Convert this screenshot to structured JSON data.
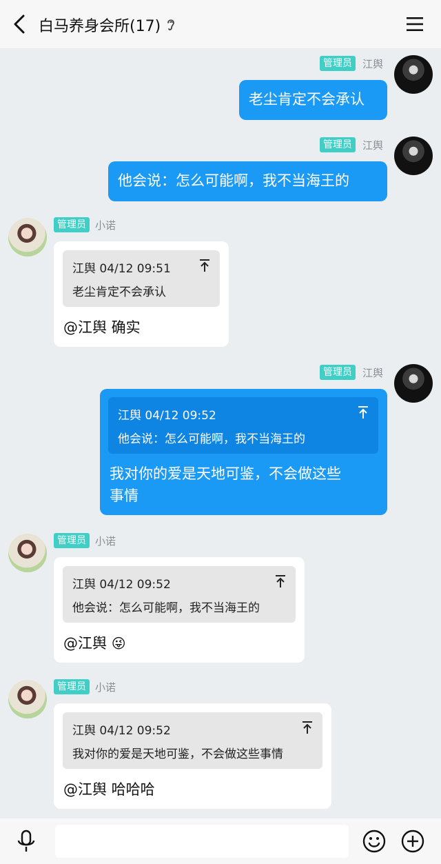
{
  "header": {
    "title": "白马养身会所(17)",
    "back_icon": "chevron-left-icon",
    "ear_icon": "ear-icon",
    "menu_icon": "menu-icon"
  },
  "messages": [
    {
      "id": 1,
      "side": "right",
      "badge": "管理员",
      "nick": "江舆",
      "text": "老尘肯定不会承认"
    },
    {
      "id": 2,
      "side": "right",
      "badge": "管理员",
      "nick": "江舆",
      "text": "他会说：怎么可能啊，我不当海王的"
    },
    {
      "id": 3,
      "side": "left",
      "badge": "管理员",
      "nick": "小诺",
      "quote": {
        "head": "江舆 04/12 09:51",
        "text": "老尘肯定不会承认"
      },
      "text": "@江舆 确实"
    },
    {
      "id": 4,
      "side": "right",
      "badge": "管理员",
      "nick": "江舆",
      "quote": {
        "head": "江舆 04/12 09:52",
        "text": "他会说：怎么可能啊，我不当海王的"
      },
      "text_line1": "我对你的爱是天地可鉴，不会做这些",
      "text_line2": "事情"
    },
    {
      "id": 5,
      "side": "left",
      "badge": "管理员",
      "nick": "小诺",
      "quote": {
        "head": "江舆 04/12 09:52",
        "text": "他会说：怎么可能啊，我不当海王的"
      },
      "text": "@江舆",
      "emoji": "😜"
    },
    {
      "id": 6,
      "side": "left",
      "badge": "管理员",
      "nick": "小诺",
      "quote": {
        "head": "江舆 04/12 09:52",
        "text": "我对你的爱是天地可鉴，不会做这些事情"
      },
      "text": "@江舆 哈哈哈"
    }
  ],
  "input_bar": {
    "mic_icon": "microphone-icon",
    "emoji_icon": "smiley-icon",
    "plus_icon": "plus-circle-icon",
    "placeholder": ""
  },
  "colors": {
    "background": "#eaeef0",
    "blue_bubble": "#1a9af5",
    "badge": "#3fcfc6"
  }
}
